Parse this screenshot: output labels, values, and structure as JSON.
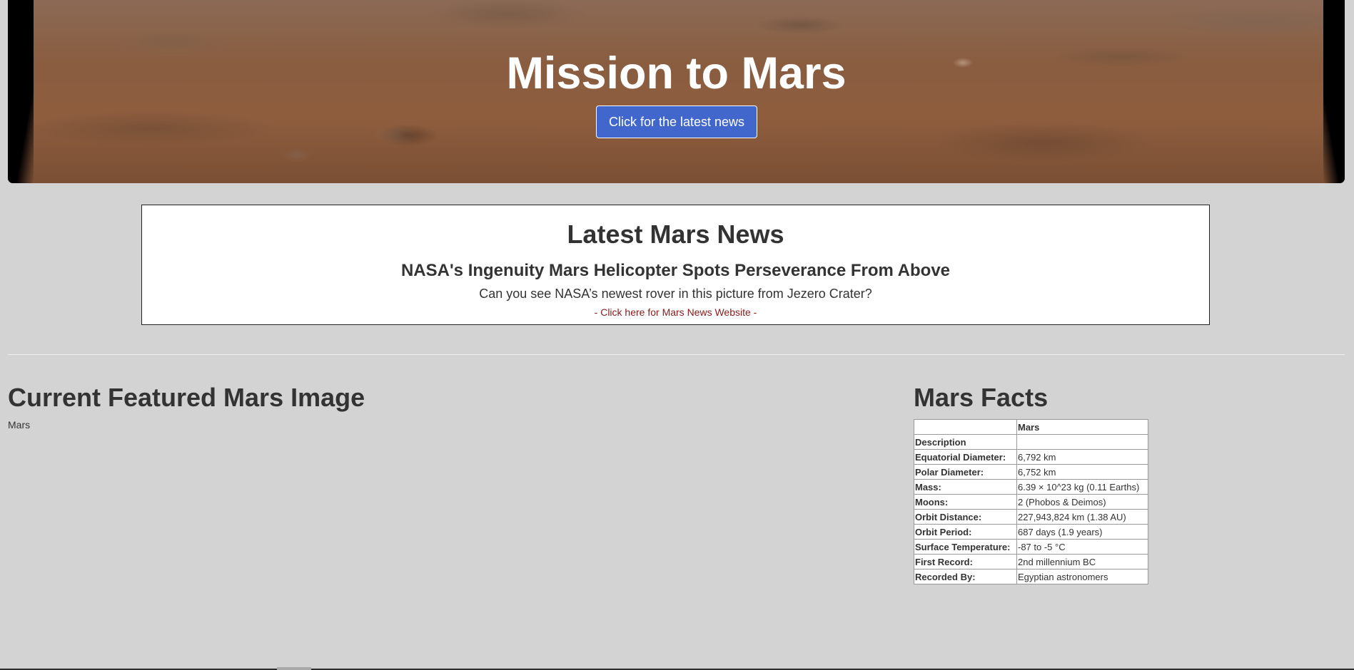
{
  "hero": {
    "title": "Mission to Mars",
    "button_label": "Click for the latest news",
    "button_color": "#4267cc"
  },
  "news": {
    "heading": "Latest Mars News",
    "title": "NASA's Ingenuity Mars Helicopter Spots Perseverance From Above",
    "teaser": "Can you see NASA’s newest rover in this picture from Jezero Crater?",
    "link_text": "- Click here for Mars News Website -",
    "link_color": "#8b1a1a"
  },
  "featured": {
    "heading": "Current Featured Mars Image",
    "image_alt": "Mars"
  },
  "facts": {
    "heading": "Mars Facts",
    "header": [
      "",
      "Mars"
    ],
    "rows": [
      {
        "label": "Description",
        "value": ""
      },
      {
        "label": "Equatorial Diameter:",
        "value": "6,792 km"
      },
      {
        "label": "Polar Diameter:",
        "value": "6,752 km"
      },
      {
        "label": "Mass:",
        "value": "6.39 × 10^23 kg (0.11 Earths)"
      },
      {
        "label": "Moons:",
        "value": "2 (Phobos & Deimos)"
      },
      {
        "label": "Orbit Distance:",
        "value": "227,943,824 km (1.38 AU)"
      },
      {
        "label": "Orbit Period:",
        "value": "687 days (1.9 years)"
      },
      {
        "label": "Surface Temperature:",
        "value": "-87 to -5 °C"
      },
      {
        "label": "First Record:",
        "value": "2nd millennium BC"
      },
      {
        "label": "Recorded By:",
        "value": "Egyptian astronomers"
      }
    ]
  }
}
